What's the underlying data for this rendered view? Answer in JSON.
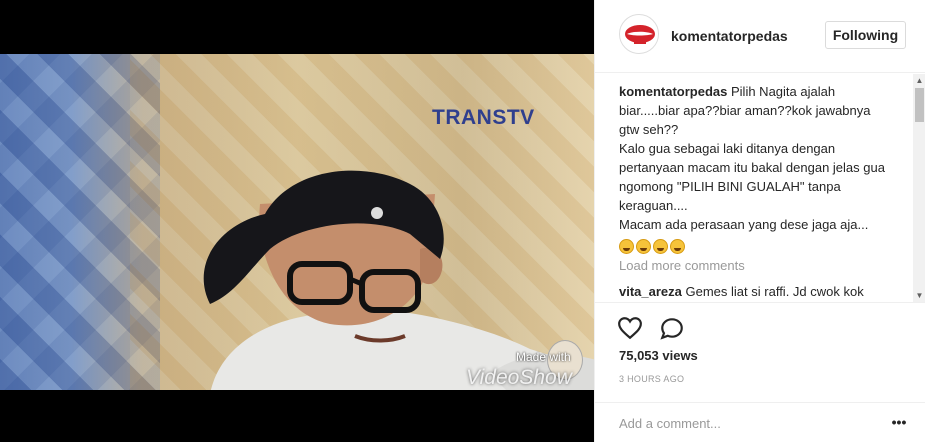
{
  "video": {
    "channel_logo": "TRANSTV",
    "watermark_small": "Made with",
    "watermark_large": "VideoShow"
  },
  "header": {
    "username": "komentatorpedas",
    "follow_label": "Following"
  },
  "caption": {
    "username": "komentatorpedas",
    "lines": [
      "Pilih Nagita ajalah biar.....biar apa??biar aman??kok jawabnya gtw seh??",
      "Kalo gua sebagai laki ditanya dengan pertanyaan macam itu bakal dengan jelas gua ngomong \"PILIH BINI GUALAH\" tanpa keraguan....",
      "Macam ada perasaan yang dese jaga aja..."
    ],
    "emojis": [
      "grinning-sweat-emoji",
      "grinning-sweat-emoji",
      "grinning-sweat-emoji",
      "grinning-sweat-emoji"
    ]
  },
  "load_more_label": "Load more comments",
  "comments": [
    {
      "username": "vita_areza",
      "text": "Gemes liat si raffi. Jd cwok kok"
    }
  ],
  "stats": {
    "views": "75,053 views",
    "time": "3 HOURS AGO"
  },
  "add_comment": {
    "placeholder": "Add a comment...",
    "more_label": "•••"
  },
  "icons": {
    "like": "heart-icon",
    "comment": "comment-icon",
    "more": "more-options-icon"
  },
  "colors": {
    "text": "#262626",
    "muted": "#999999",
    "border": "#efefef",
    "logo_blue": "#2f3f8e"
  }
}
